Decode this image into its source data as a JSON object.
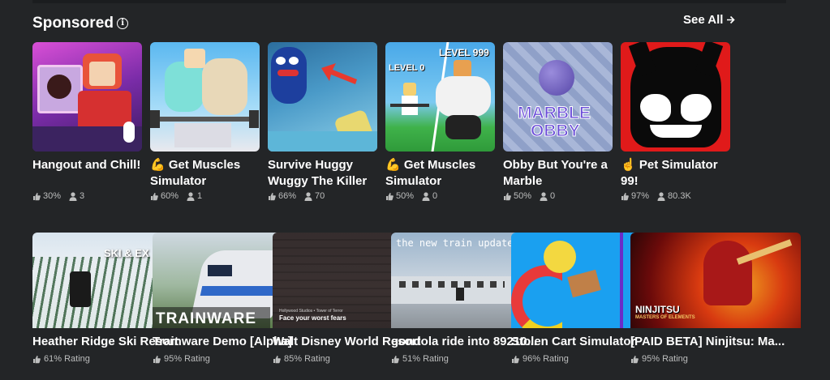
{
  "sponsored": {
    "title": "Sponsored",
    "info_icon": "i",
    "see_all": "See All",
    "games": [
      {
        "name": "Hangout and Chill!",
        "rating": "30%",
        "players": "3",
        "thumb_label": ""
      },
      {
        "name": "💪 Get Muscles Simulator",
        "rating": "60%",
        "players": "1",
        "thumb_label": ""
      },
      {
        "name": "Survive Huggy Wuggy The Killer",
        "rating": "66%",
        "players": "70",
        "thumb_label": ""
      },
      {
        "name": "💪 Get Muscles Simulator",
        "rating": "50%",
        "players": "0",
        "thumb_label": ""
      },
      {
        "name": "Obby But You're a Marble",
        "rating": "50%",
        "players": "0",
        "thumb_label": ""
      },
      {
        "name": "☝️ Pet Simulator 99!",
        "rating": "97%",
        "players": "80.3K",
        "thumb_label": ""
      }
    ],
    "thumb_texts": {
      "level0": "LEVEL 0",
      "level999": "LEVEL 999",
      "marble_line1": "MARBLE",
      "marble_line2": "OBBY"
    }
  },
  "experiences": [
    {
      "name": "Heather Ridge Ski Resort",
      "rating": "61% Rating",
      "thumb_text": "SKI & EX"
    },
    {
      "name": "Trainware Demo [Alpha]",
      "rating": "95% Rating",
      "thumb_text": "TRAINWARE"
    },
    {
      "name": "Walt Disney World Resort",
      "rating": "85% Rating",
      "thumb_text": "Face your worst fears",
      "thumb_subtext": "Hollywood Studios • Tower of Terror"
    },
    {
      "name": "gondola ride into 89210...",
      "rating": "51% Rating",
      "thumb_text": "the new train update"
    },
    {
      "name": "Stolen Cart Simulator",
      "rating": "96% Rating",
      "thumb_text": ""
    },
    {
      "name": "[PAID BETA] Ninjitsu: Ma...",
      "rating": "95% Rating",
      "thumb_text": "NINJITSU",
      "thumb_subtext": "MASTERS OF ELEMENTS"
    }
  ],
  "colors": {
    "background": "#232527",
    "text": "#ffffff",
    "subtext": "#bdbebe"
  }
}
